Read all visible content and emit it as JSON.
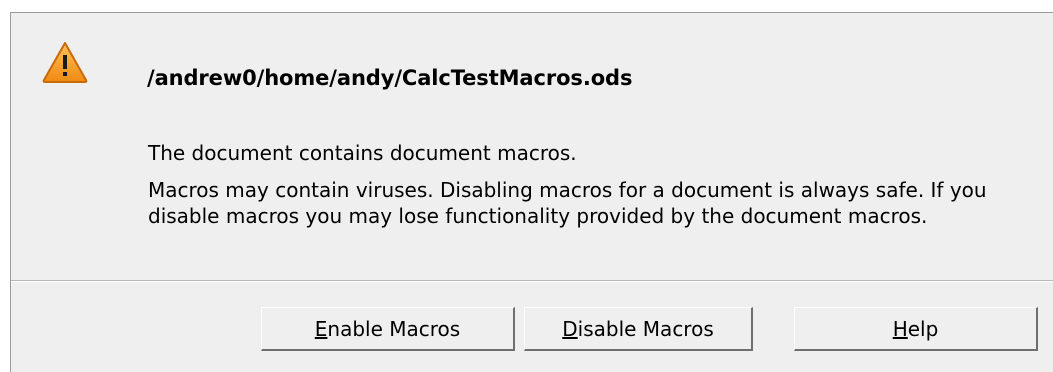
{
  "dialog": {
    "title": "/andrew0/home/andy/CalcTestMacros.ods",
    "message_primary": "The document contains document macros.",
    "message_secondary": "Macros may contain viruses. Disabling macros for a document is always safe. If you disable macros you may lose functionality provided by the document macros.",
    "icon": "warning-triangle-icon",
    "colors": {
      "icon_fill": "#f39a1f",
      "background": "#efefef"
    }
  },
  "buttons": {
    "enable": {
      "mnemonic": "E",
      "rest": "nable Macros"
    },
    "disable": {
      "mnemonic": "D",
      "rest": "isable Macros"
    },
    "help": {
      "mnemonic": "H",
      "rest": "elp"
    }
  }
}
